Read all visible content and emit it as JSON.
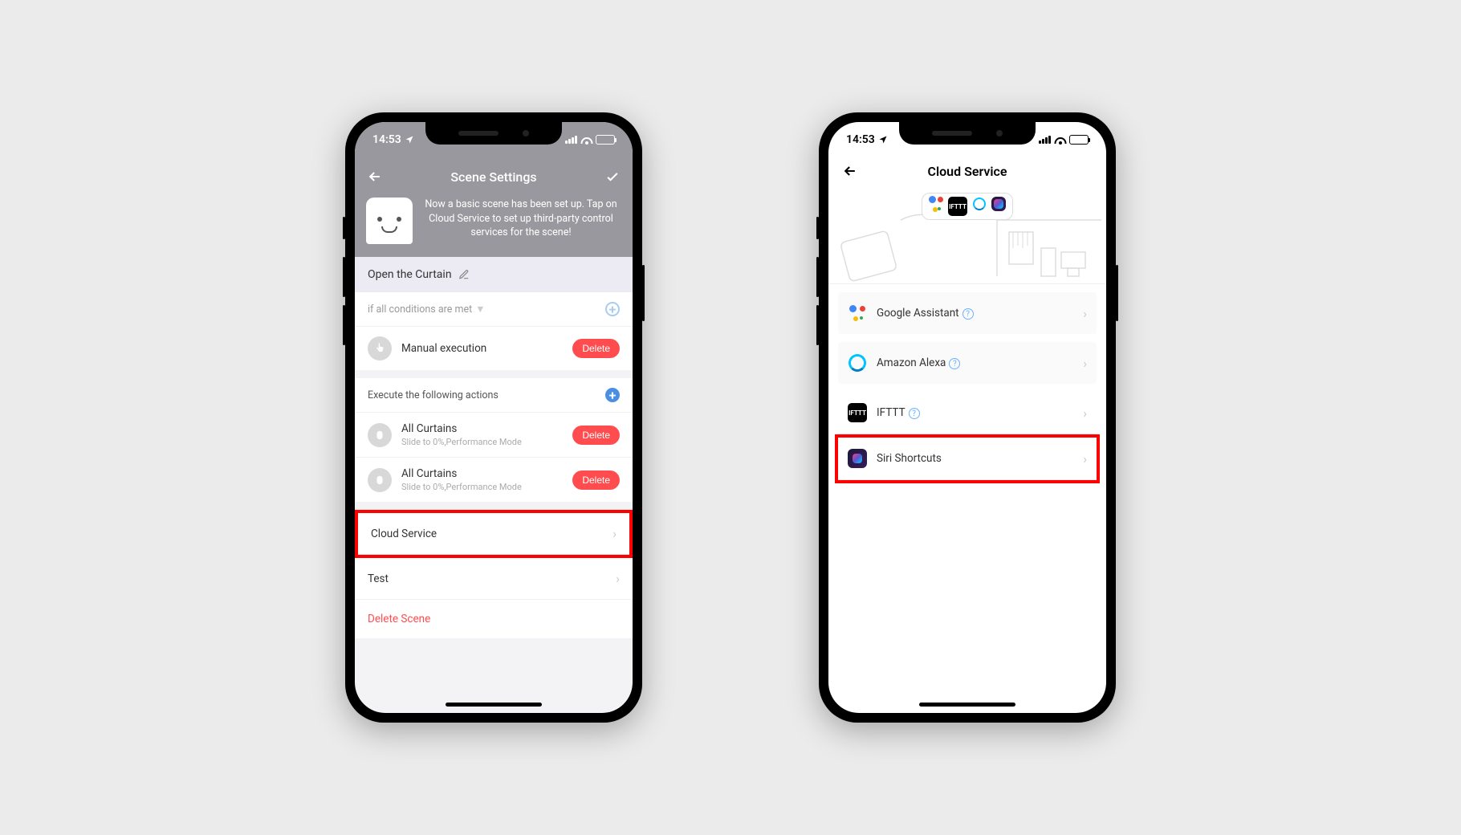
{
  "status": {
    "time": "14:53"
  },
  "screen1": {
    "header_title": "Scene Settings",
    "description": "Now a basic scene has been set up. Tap on Cloud Service to set up third-party control services for the scene!",
    "scene_name": "Open the Curtain",
    "condition_header": "if all conditions are met",
    "manual_exec": "Manual execution",
    "delete_label": "Delete",
    "actions_header": "Execute the following actions",
    "action1_title": "All Curtains",
    "action1_sub": "Slide to 0%,Performance Mode",
    "action2_title": "All Curtains",
    "action2_sub": "Slide to 0%,Performance Mode",
    "cloud_service": "Cloud Service",
    "test": "Test",
    "delete_scene": "Delete Scene"
  },
  "screen2": {
    "header_title": "Cloud Service",
    "services": {
      "google": "Google Assistant",
      "alexa": "Amazon Alexa",
      "ifttt": "IFTTT",
      "siri": "Siri Shortcuts"
    }
  }
}
